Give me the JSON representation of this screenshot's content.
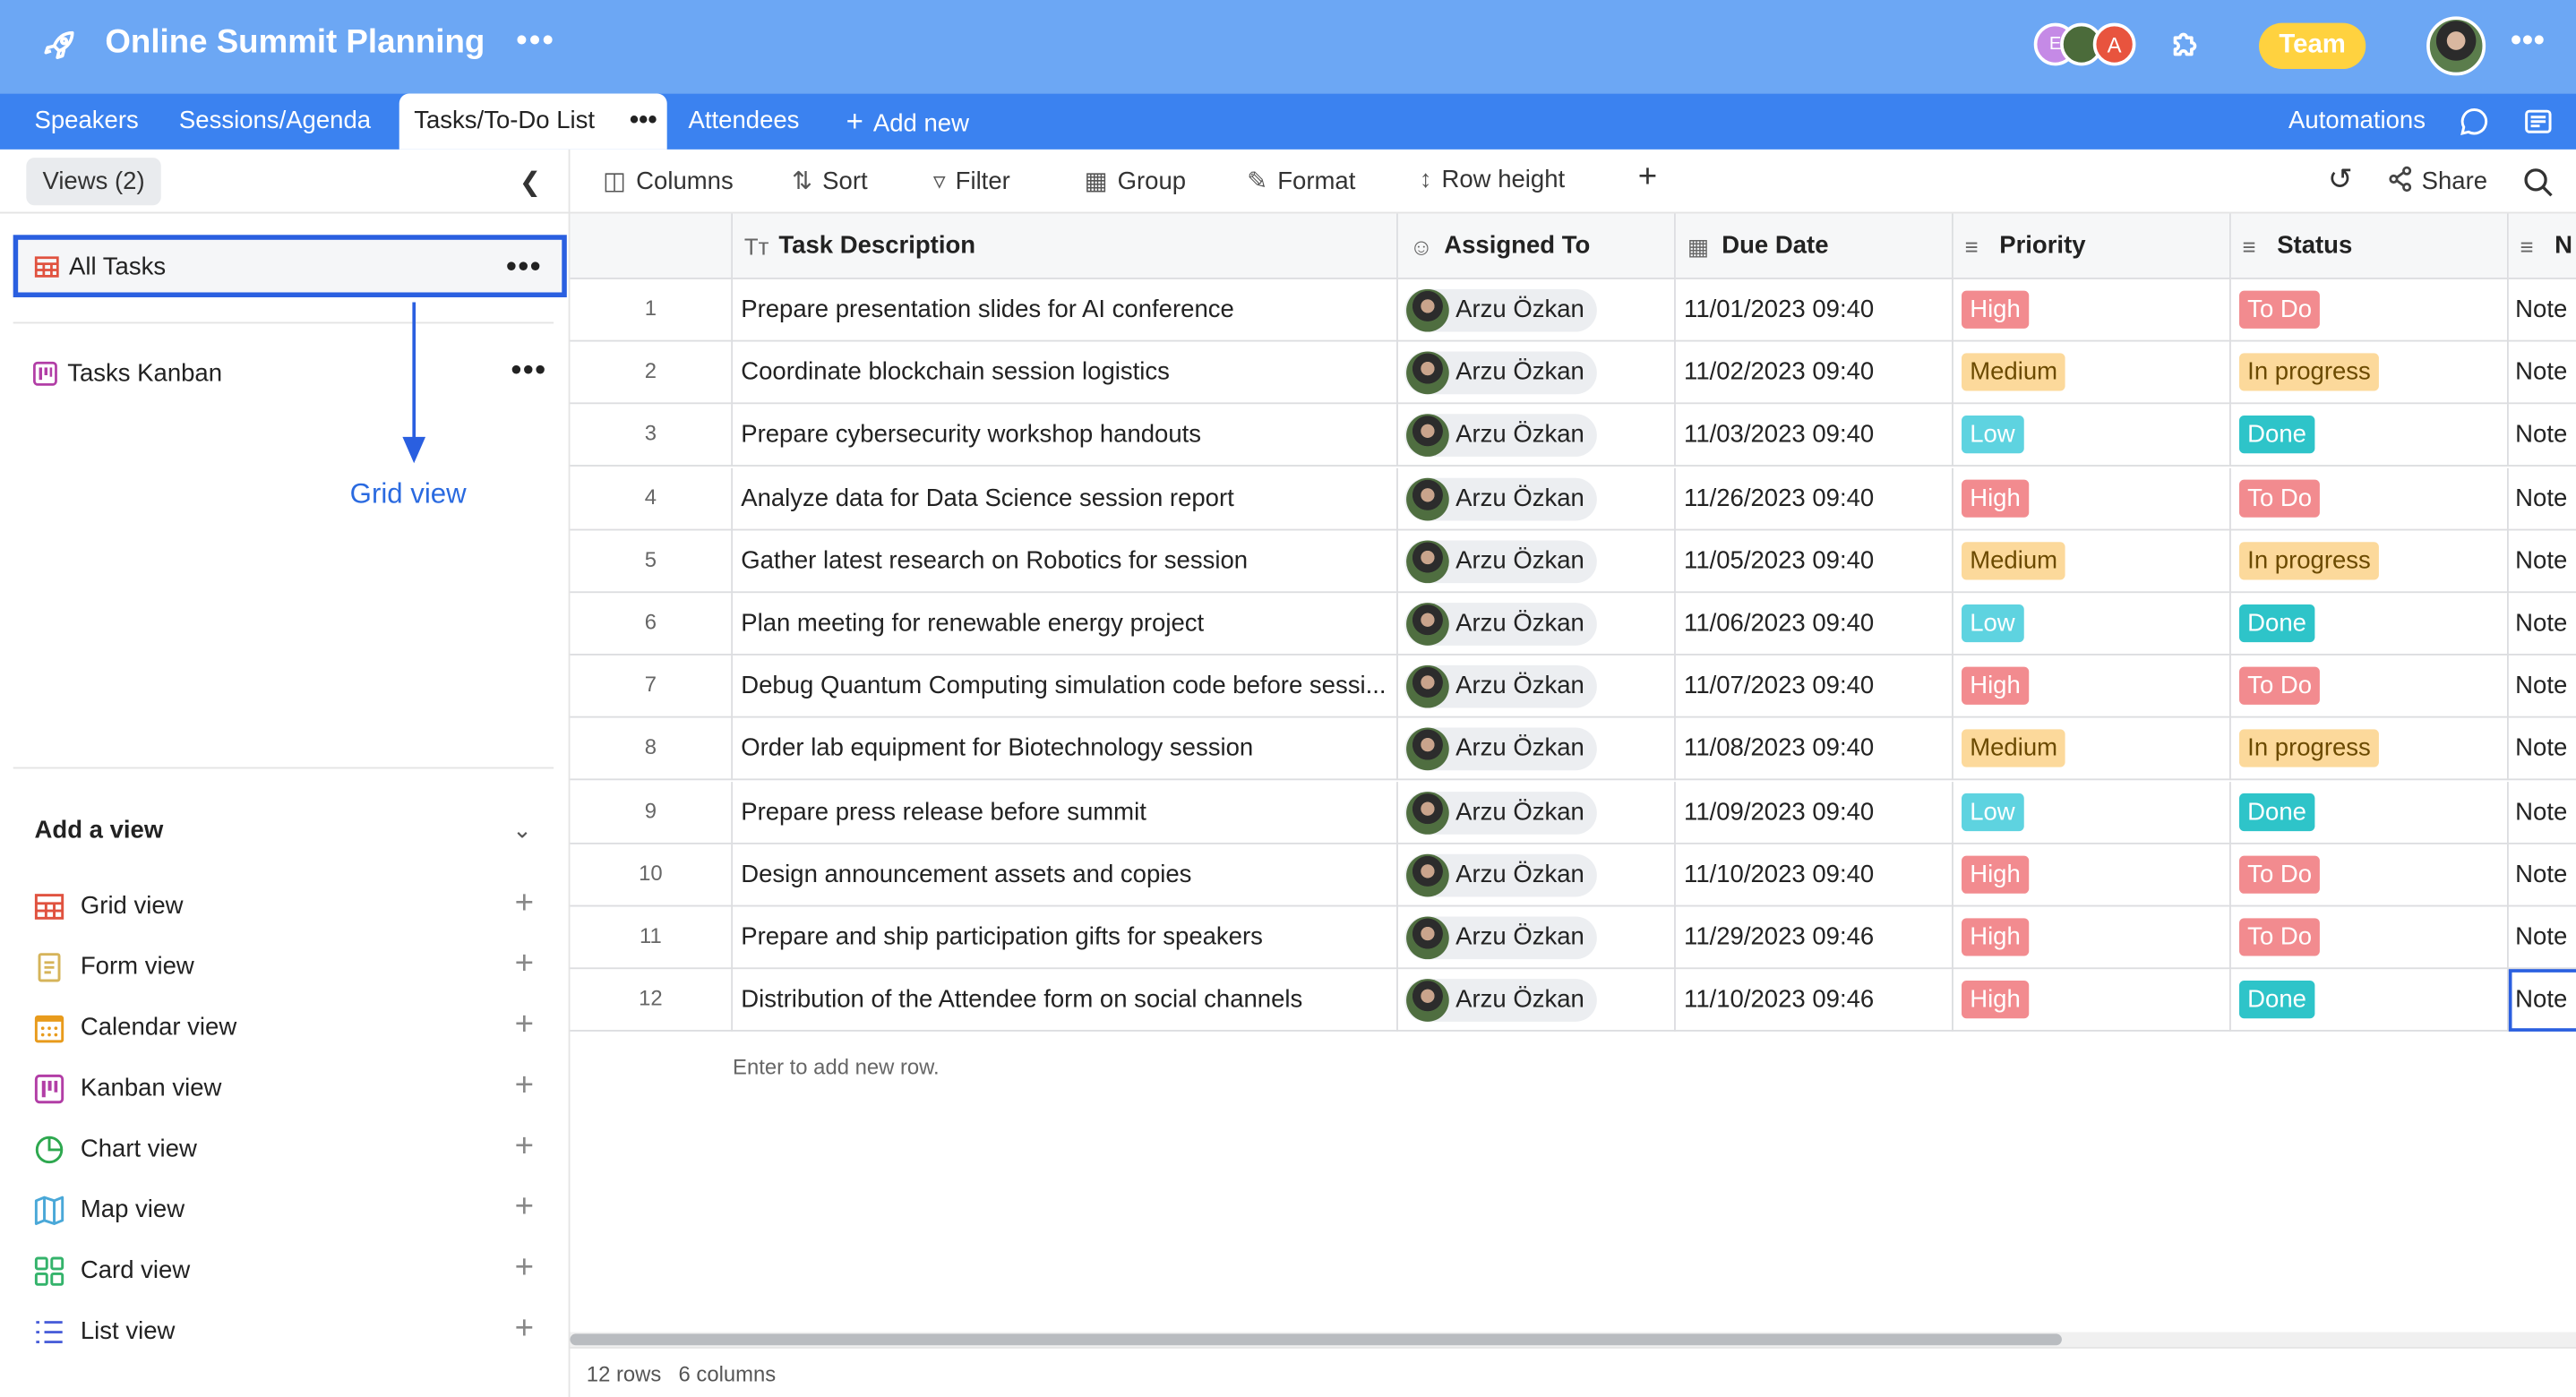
{
  "header": {
    "app_title": "Online Summit Planning",
    "collaborators": [
      "E",
      "",
      "A"
    ],
    "team_label": "Team",
    "brand_color": "#6ca7f4"
  },
  "tabs": {
    "items": [
      "Speakers",
      "Sessions/Agenda",
      "Tasks/To-Do List",
      "Attendees"
    ],
    "active": "Tasks/To-Do List",
    "add_new": "Add new",
    "automations": "Automations"
  },
  "sidebar": {
    "views_label": "Views (2)",
    "views": [
      {
        "name": "All Tasks",
        "icon": "grid-icon",
        "selected": true
      },
      {
        "name": "Tasks Kanban",
        "icon": "kanban-icon",
        "selected": false
      }
    ],
    "annotation": "Grid view",
    "add_view_title": "Add a view",
    "add_views": [
      {
        "label": "Grid view",
        "icon": "grid-icon",
        "color": "#e0523f"
      },
      {
        "label": "Form view",
        "icon": "form-icon",
        "color": "#d6b45a"
      },
      {
        "label": "Calendar view",
        "icon": "calendar-icon",
        "color": "#e89b1c"
      },
      {
        "label": "Kanban view",
        "icon": "kanban-icon",
        "color": "#b23ea6"
      },
      {
        "label": "Chart view",
        "icon": "chart-icon",
        "color": "#2ea84f"
      },
      {
        "label": "Map view",
        "icon": "map-icon",
        "color": "#4aa8d8"
      },
      {
        "label": "Card view",
        "icon": "card-icon",
        "color": "#34b36b"
      },
      {
        "label": "List view",
        "icon": "list-icon",
        "color": "#4a5fd9"
      }
    ]
  },
  "toolbar": {
    "columns": "Columns",
    "sort": "Sort",
    "filter": "Filter",
    "group": "Group",
    "format": "Format",
    "row_height": "Row height",
    "share": "Share"
  },
  "grid": {
    "columns": [
      "Task Description",
      "Assigned To",
      "Due Date",
      "Priority",
      "Status",
      "N"
    ],
    "rows": [
      {
        "n": "1",
        "task": "Prepare presentation slides for AI conference",
        "assignee": "Arzu Özkan",
        "due": "11/01/2023 09:40",
        "priority": "High",
        "status": "To Do",
        "note": "Note"
      },
      {
        "n": "2",
        "task": "Coordinate blockchain session logistics",
        "assignee": "Arzu Özkan",
        "due": "11/02/2023 09:40",
        "priority": "Medium",
        "status": "In progress",
        "note": "Note"
      },
      {
        "n": "3",
        "task": "Prepare cybersecurity workshop handouts",
        "assignee": "Arzu Özkan",
        "due": "11/03/2023 09:40",
        "priority": "Low",
        "status": "Done",
        "note": "Note"
      },
      {
        "n": "4",
        "task": "Analyze data for Data Science session report",
        "assignee": "Arzu Özkan",
        "due": "11/26/2023 09:40",
        "priority": "High",
        "status": "To Do",
        "note": "Note"
      },
      {
        "n": "5",
        "task": "Gather latest research on Robotics for session",
        "assignee": "Arzu Özkan",
        "due": "11/05/2023 09:40",
        "priority": "Medium",
        "status": "In progress",
        "note": "Note"
      },
      {
        "n": "6",
        "task": "Plan meeting for renewable energy project",
        "assignee": "Arzu Özkan",
        "due": "11/06/2023 09:40",
        "priority": "Low",
        "status": "Done",
        "note": "Note"
      },
      {
        "n": "7",
        "task": "Debug Quantum Computing simulation code before sessi...",
        "assignee": "Arzu Özkan",
        "due": "11/07/2023 09:40",
        "priority": "High",
        "status": "To Do",
        "note": "Note"
      },
      {
        "n": "8",
        "task": "Order lab equipment for Biotechnology session",
        "assignee": "Arzu Özkan",
        "due": "11/08/2023 09:40",
        "priority": "Medium",
        "status": "In progress",
        "note": "Note"
      },
      {
        "n": "9",
        "task": "Prepare press release before summit",
        "assignee": "Arzu Özkan",
        "due": "11/09/2023 09:40",
        "priority": "Low",
        "status": "Done",
        "note": "Note"
      },
      {
        "n": "10",
        "task": "Design announcement assets and copies",
        "assignee": "Arzu Özkan",
        "due": "11/10/2023 09:40",
        "priority": "High",
        "status": "To Do",
        "note": "Note"
      },
      {
        "n": "11",
        "task": "Prepare and ship participation gifts for speakers",
        "assignee": "Arzu Özkan",
        "due": "11/29/2023 09:46",
        "priority": "High",
        "status": "To Do",
        "note": "Note"
      },
      {
        "n": "12",
        "task": "Distribution of the Attendee form on social channels",
        "assignee": "Arzu Özkan",
        "due": "11/10/2023 09:46",
        "priority": "High",
        "status": "Done",
        "note": "Note"
      }
    ],
    "add_row_hint": "Enter to add new row.",
    "badge_colors": {
      "High": "#f28b8f",
      "Medium": "#fcd99b",
      "Low": "#5ed3e0",
      "To Do": "#f28b8f",
      "In progress": "#fcd99b",
      "Done": "#2ec4c9"
    }
  },
  "footer": {
    "rows": "12 rows",
    "columns": "6 columns"
  }
}
